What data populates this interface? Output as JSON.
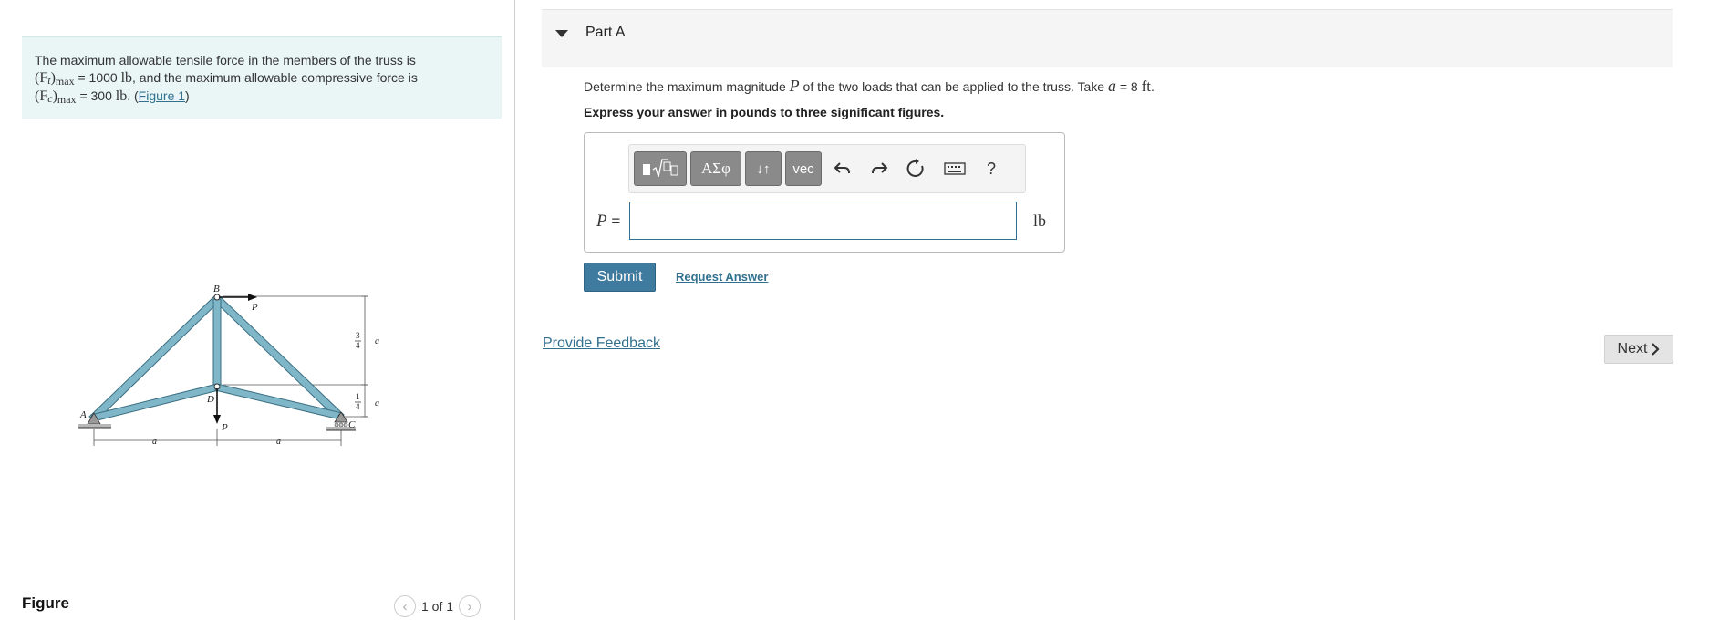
{
  "problem": {
    "line1": "The maximum allowable tensile force in the members of the truss is",
    "ft_symbol": "(F",
    "ft_sub": "t",
    "ft_close": ")",
    "max_sub": "max",
    "ft_value": " = 1000 ",
    "ft_unit": "lb",
    "line2_rest": ", and the maximum allowable compressive force is",
    "fc_symbol": "(F",
    "fc_sub": "c",
    "fc_close": ")",
    "fc_max_sub": "max",
    "fc_value": " = 300 ",
    "fc_unit": "lb",
    "period": ". (",
    "figure_link": "Figure 1",
    "close_paren": ")"
  },
  "figure": {
    "label": "Figure",
    "pager_text": "1 of 1",
    "prev_icon": "chevron-left-icon",
    "next_icon": "chevron-right-icon",
    "labels": {
      "A": "A",
      "B": "B",
      "C": "C",
      "D": "D",
      "P_top": "P",
      "P_bottom": "P",
      "a_left": "a",
      "a_right": "a",
      "three": "3",
      "four_top": "4",
      "a_top": "a",
      "one": "1",
      "four_bottom": "4",
      "a_bottom": "a"
    },
    "member_color": "#7fb6c8"
  },
  "part": {
    "title": "Part A",
    "question_pre": "Determine the maximum magnitude ",
    "question_var": "P",
    "question_mid": " of the two loads that can be applied to the truss. Take ",
    "question_a": "a",
    "question_eq": " = 8 ",
    "question_unit": "ft",
    "question_end": ".",
    "instruction": "Express your answer in pounds to three significant figures."
  },
  "toolbar": {
    "template_icon": "template-sqrt-icon",
    "greek_label": "ΑΣφ",
    "arrows_label": "↓↑",
    "vec_label": "vec",
    "undo_icon": "undo-icon",
    "redo_icon": "redo-icon",
    "reset_icon": "reset-icon",
    "keyboard_icon": "keyboard-icon",
    "help_label": "?"
  },
  "answer": {
    "var": "P",
    "eq": " = ",
    "value": "",
    "unit": "lb"
  },
  "buttons": {
    "submit": "Submit",
    "request_answer": "Request Answer",
    "provide_feedback": "Provide Feedback",
    "next": "Next",
    "next_icon": "chevron-right-icon"
  },
  "colors": {
    "accent": "#3f7b9f",
    "link": "#31708f",
    "problem_bg": "#eaf6f6"
  }
}
